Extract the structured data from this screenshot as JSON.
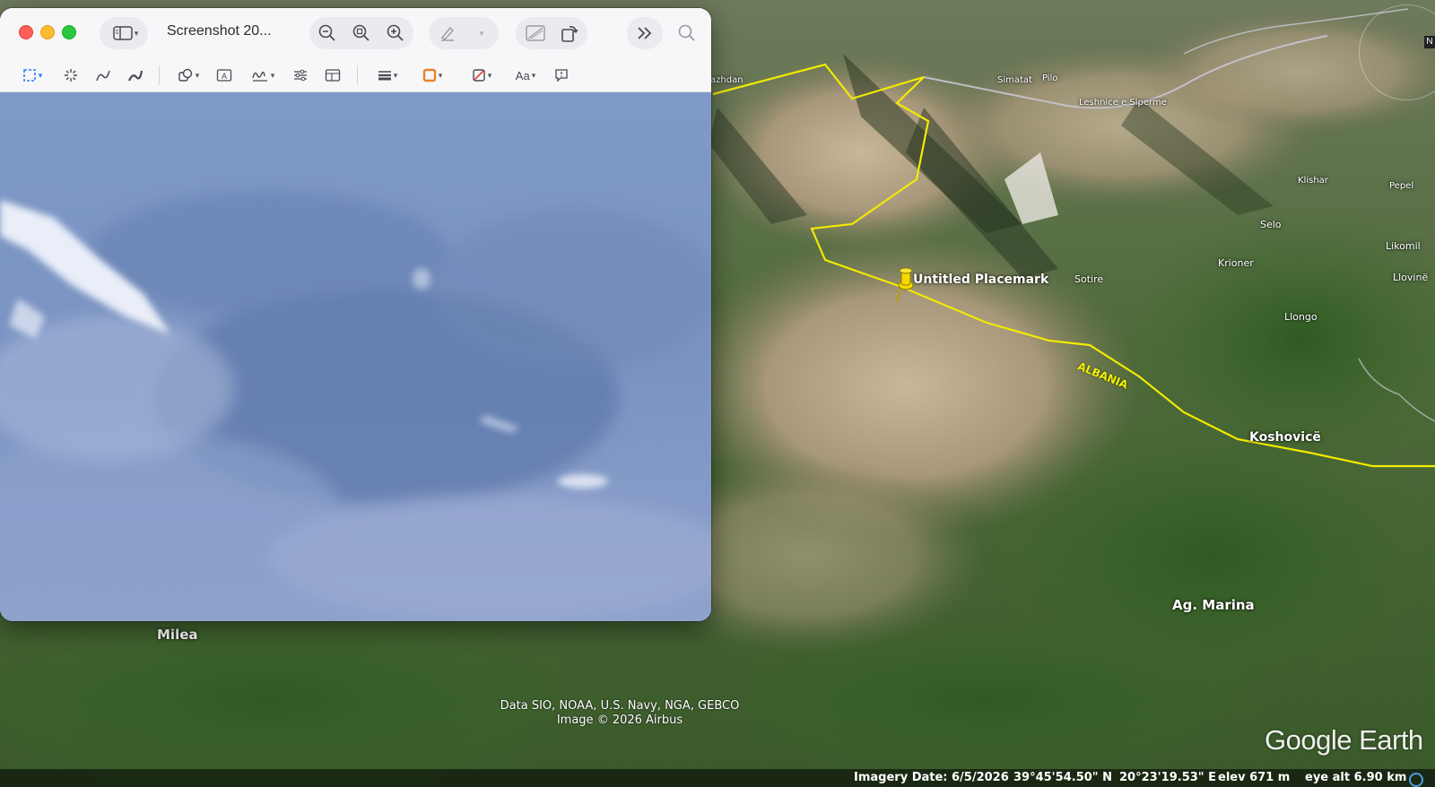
{
  "window": {
    "title": "Screenshot 20...",
    "icons": {
      "sidebar": "sidebar-icon",
      "zoom_out": "zoom-out-icon",
      "zoom_fit": "zoom-fit-icon",
      "zoom_in": "zoom-in-icon",
      "highlight": "highlighter-icon",
      "crop": "crop-icon",
      "rotate": "rotate-icon",
      "more": "chevron-double-right-icon",
      "search": "search-icon"
    },
    "markup_tools": [
      "rectangular-selection-icon",
      "instant-alpha-icon",
      "sketch-icon",
      "draw-icon",
      "shapes-icon",
      "text-box-icon",
      "signature-icon",
      "adjust-color-icon",
      "page-layout-icon",
      "line-style-icon",
      "border-color-icon",
      "fill-color-icon",
      "text-style-icon",
      "annotate-icon"
    ],
    "text_style_label": "Aa"
  },
  "map": {
    "labels": {
      "placemark": "Untitled Placemark",
      "country": "ALBANIA",
      "koshovice": "Koshovicë",
      "ag_marina": "Ag. Marina",
      "milea": "Milea",
      "sotire": "Sotire",
      "kroner": "Krioner",
      "llongo": "Llongo",
      "selo": "Selo",
      "klishar": "Klishar",
      "pepel": "Pepel",
      "likomil": "Likomil",
      "llovine": "Llovinë",
      "simatat": "Simatat",
      "pilo": "Pilo",
      "leshnice": "Leshnice e Siperme",
      "zhdan": "azhdan"
    },
    "attribution_line1": "Data SIO, NOAA, U.S. Navy, NGA, GEBCO",
    "attribution_line2": "Image © 2026 Airbus",
    "logo": "Google Earth",
    "compass_letter": "N",
    "colors": {
      "border_line": "#f2ea00",
      "placemark": "#f5d800",
      "road": "#c9c9d6"
    }
  },
  "status": {
    "imagery_date": "Imagery Date: 6/5/2026",
    "lat": "39°45'54.50\" N",
    "lon": "20°23'19.53\" E",
    "elev": "elev   671 m",
    "eye_alt": "eye alt  6.90 km"
  }
}
